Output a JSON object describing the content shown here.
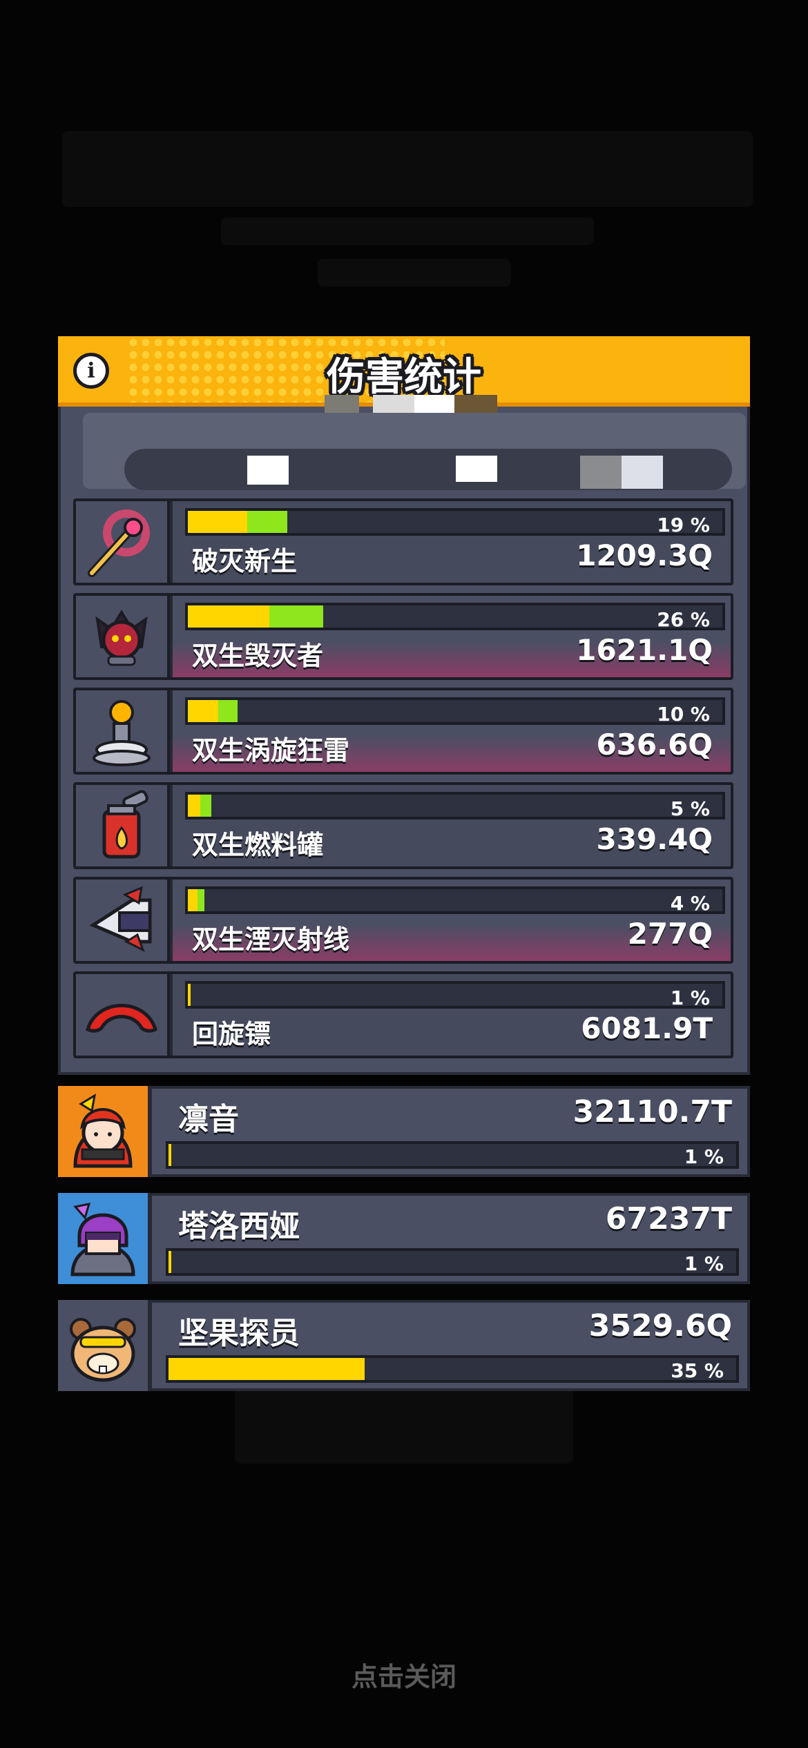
{
  "panel": {
    "title": "伤害统计",
    "info_icon": "info-icon"
  },
  "weapons": [
    {
      "name": "破灭新生",
      "value": "1209.3Q",
      "percent_label": "19 %",
      "percent": 19,
      "icon": "axe-staff-icon",
      "highlight": false
    },
    {
      "name": "双生毁灭者",
      "value": "1621.1Q",
      "percent_label": "26 %",
      "percent": 26,
      "icon": "demon-drone-icon",
      "highlight": true
    },
    {
      "name": "双生涡旋狂雷",
      "value": "636.6Q",
      "percent_label": "10 %",
      "percent": 10,
      "icon": "tesla-coil-icon",
      "highlight": true
    },
    {
      "name": "双生燃料罐",
      "value": "339.4Q",
      "percent_label": "5 %",
      "percent": 5,
      "icon": "fuel-tank-icon",
      "highlight": false
    },
    {
      "name": "双生湮灭射线",
      "value": "277Q",
      "percent_label": "4 %",
      "percent": 4,
      "icon": "ray-cannon-icon",
      "highlight": true
    },
    {
      "name": "回旋镖",
      "value": "6081.9T",
      "percent_label": "1 %",
      "percent": 1,
      "icon": "boomerang-icon",
      "highlight": false
    }
  ],
  "heroes": [
    {
      "name": "凛音",
      "value": "32110.7T",
      "percent_label": "1 %",
      "percent": 1,
      "icon": "hero-rinne-avatar",
      "bg": "#f28a1a"
    },
    {
      "name": "塔洛西娅",
      "value": "67237T",
      "percent_label": "1 %",
      "percent": 1,
      "icon": "hero-talosia-avatar",
      "bg": "#3f8ed8"
    },
    {
      "name": "坚果探员",
      "value": "3529.6Q",
      "percent_label": "35 %",
      "percent": 35,
      "icon": "hero-nut-agent-avatar",
      "bg": "#4a4f63"
    }
  ],
  "footer": {
    "close_hint": "点击关闭"
  },
  "colors": {
    "header": "#fbb30d",
    "bar_primary": "#ffd600",
    "bar_secondary": "#8fe61c",
    "panel": "#4a4f63"
  }
}
